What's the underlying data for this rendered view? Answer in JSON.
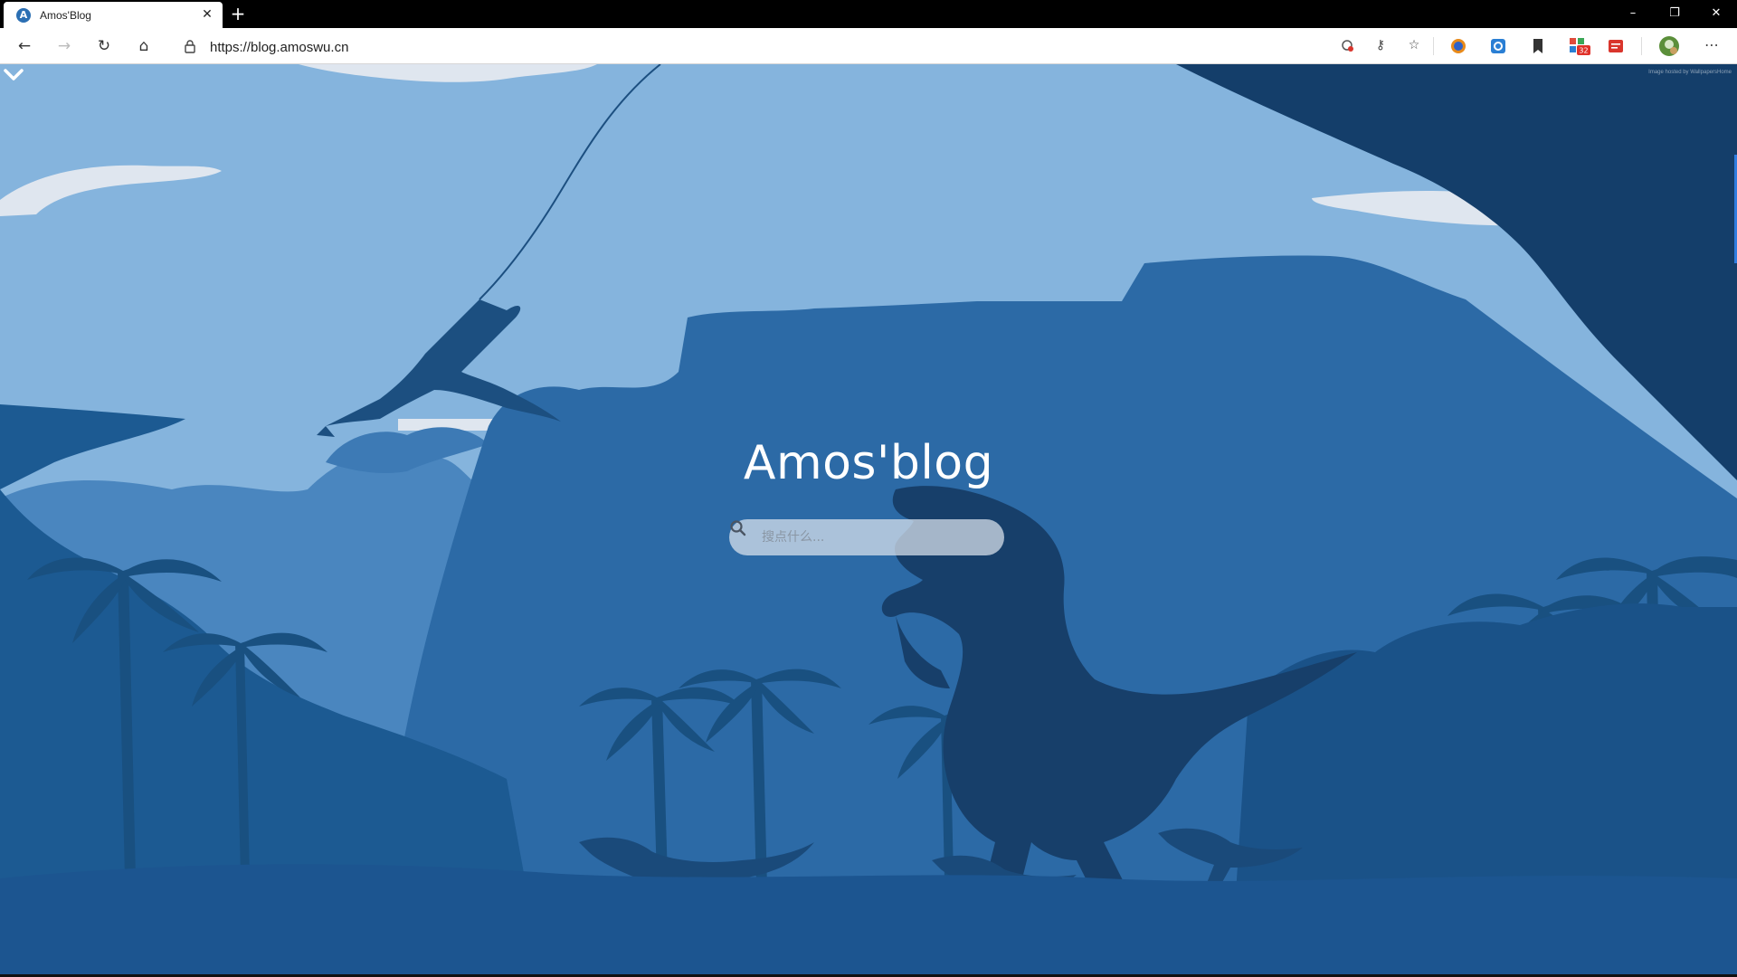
{
  "browser": {
    "tab": {
      "favicon_letter": "A",
      "title": "Amos'Blog"
    },
    "window_controls": {
      "minimize": "–",
      "restore": "❐",
      "close": "✕"
    },
    "address": {
      "url": "https://blog.amoswu.cn"
    },
    "toolbar_icons": [
      "back-icon",
      "forward-icon",
      "refresh-icon",
      "home-icon",
      "lock-icon",
      "tracking-icon",
      "key-icon",
      "favorite-star-icon",
      "extension-icon",
      "bookmark-icon",
      "badge-extension-icon",
      "red-extension-icon",
      "profile-avatar",
      "more-menu-icon"
    ],
    "extension_badge": "32"
  },
  "page": {
    "credit": "Image hosted by WallpapersHome",
    "title": "Amos'blog",
    "search": {
      "placeholder": "搜点什么..."
    },
    "scroll_hint_icon": "chevron-down-icon"
  },
  "colors": {
    "sky": "#85b4dd",
    "far_layer": "#4a86bf",
    "mid_layer": "#2c6aa6",
    "near_layer": "#1c5a92",
    "dark_layer": "#143e6a",
    "cloud": "#dfe6ef",
    "accent": "#2f7de0"
  }
}
